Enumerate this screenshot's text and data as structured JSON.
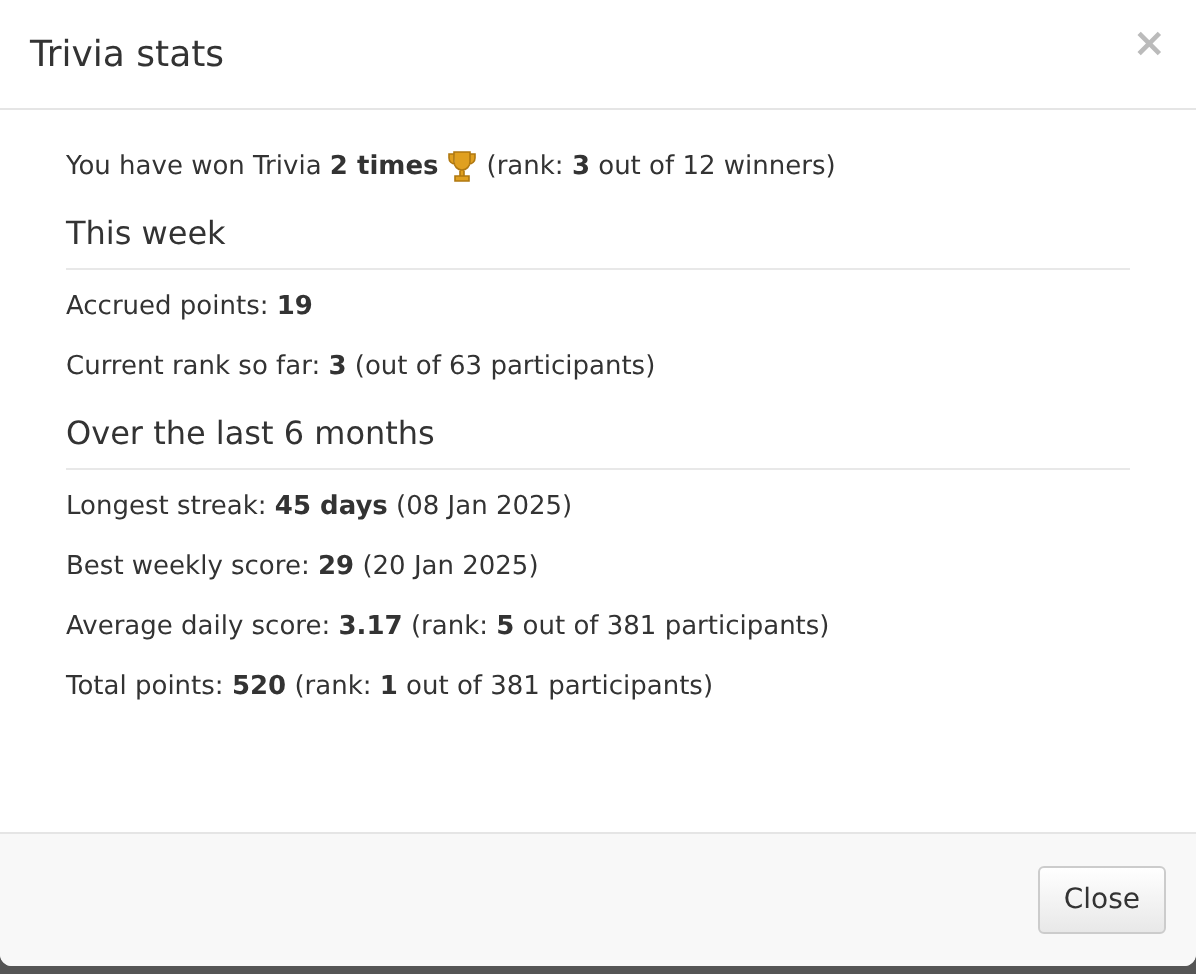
{
  "window": {
    "title": "Trivia stats",
    "close_symbol": "×"
  },
  "intro": {
    "before": "You have won Trivia **2 times**",
    "after": "(rank: **3** out of 12 winners)"
  },
  "sections": [
    {
      "heading": "This week",
      "lines": [
        "Accrued points: **19**",
        "Current rank so far: **3** (out of 63 participants)"
      ]
    },
    {
      "heading": "Over the last 6 months",
      "lines": [
        "Longest streak: **45 days** (08 Jan 2025)",
        "Best weekly score: **29** (20 Jan 2025)",
        "Average daily score: **3.17** (rank: **5** out of 381 participants)",
        "Total points: **520** (rank: **1** out of 381 participants)"
      ]
    }
  ],
  "buttons": [
    "Close"
  ]
}
